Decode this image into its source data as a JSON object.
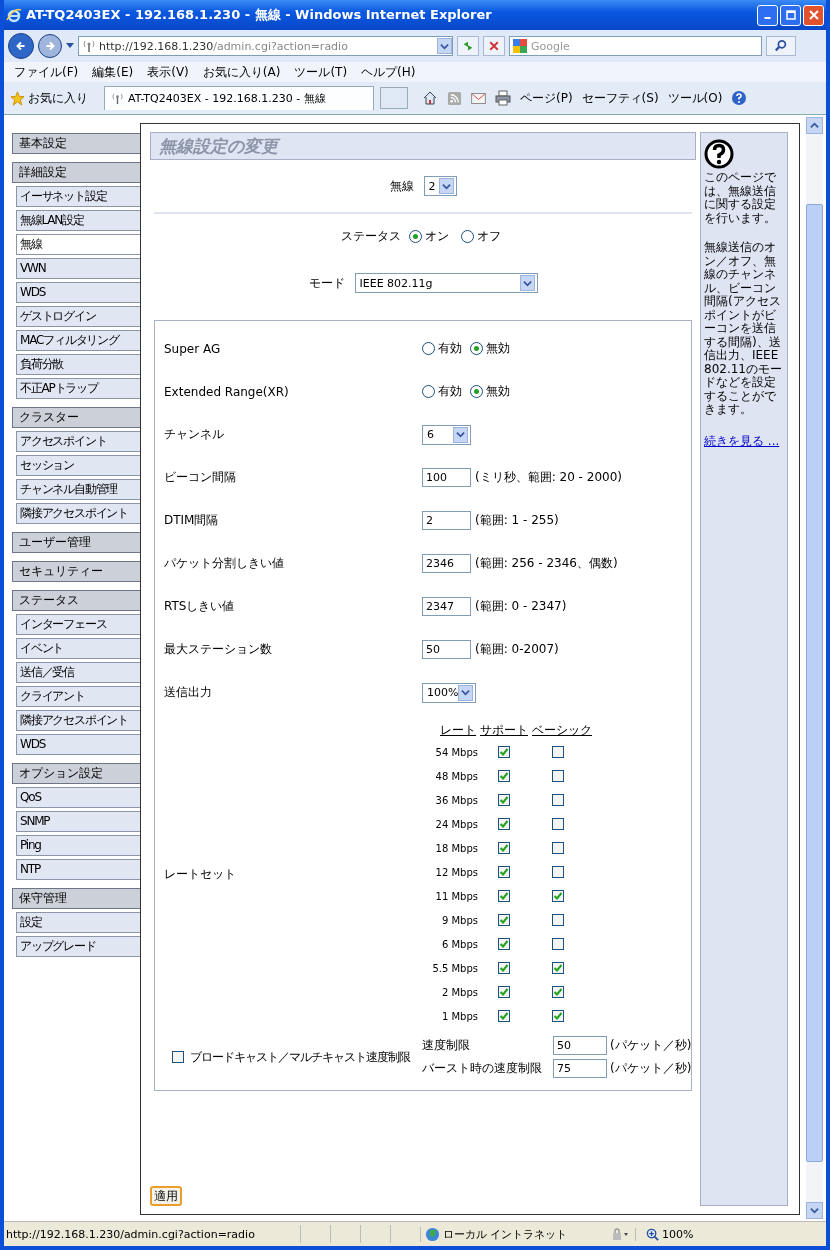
{
  "window": {
    "title": "AT-TQ2403EX - 192.168.1.230 - 無線 - Windows Internet Explorer"
  },
  "address_bar": {
    "host": "http://192.168.1.230",
    "path": "/admin.cgi?action=radio"
  },
  "search_field": {
    "placeholder": "Google"
  },
  "menu_bar": [
    "ファイル(F)",
    "編集(E)",
    "表示(V)",
    "お気に入り(A)",
    "ツール(T)",
    "ヘルプ(H)"
  ],
  "favorites_bar": {
    "favorites": "お気に入り",
    "tab_title": "AT-TQ2403EX - 192.168.1.230 - 無線",
    "commands": [
      "ページ(P)",
      "セーフティ(S)",
      "ツール(O)"
    ]
  },
  "sidebar": [
    {
      "title": "基本設定"
    },
    {
      "title": "詳細設定",
      "items": [
        {
          "label": "イーサネット設定",
          "selected": false
        },
        {
          "label": "無線LAN設定",
          "selected": false
        },
        {
          "label": "無線",
          "selected": true
        },
        {
          "label": "VWN",
          "selected": false
        },
        {
          "label": "WDS",
          "selected": false
        },
        {
          "label": "ゲストログイン",
          "selected": false
        },
        {
          "label": "MACフィルタリング",
          "selected": false
        },
        {
          "label": "負荷分散",
          "selected": false
        },
        {
          "label": "不正APトラップ",
          "selected": false
        }
      ]
    },
    {
      "title": "クラスター",
      "items": [
        {
          "label": "アクセスポイント",
          "selected": false
        },
        {
          "label": "セッション",
          "selected": false
        },
        {
          "label": "チャンネル自動管理",
          "selected": false
        },
        {
          "label": "隣接アクセスポイント",
          "selected": false
        }
      ]
    },
    {
      "title": "ユーザー管理"
    },
    {
      "title": "セキュリティー"
    },
    {
      "title": "ステータス",
      "items": [
        {
          "label": "インターフェース",
          "selected": false
        },
        {
          "label": "イベント",
          "selected": false
        },
        {
          "label": "送信／受信",
          "selected": false
        },
        {
          "label": "クライアント",
          "selected": false
        },
        {
          "label": "隣接アクセスポイント",
          "selected": false
        },
        {
          "label": "WDS",
          "selected": false
        }
      ]
    },
    {
      "title": "オプション設定",
      "items": [
        {
          "label": "QoS",
          "selected": false
        },
        {
          "label": "SNMP",
          "selected": false
        },
        {
          "label": "Ping",
          "selected": false
        },
        {
          "label": "NTP",
          "selected": false
        }
      ]
    },
    {
      "title": "保守管理",
      "items": [
        {
          "label": "設定",
          "selected": false
        },
        {
          "label": "アップグレード",
          "selected": false
        }
      ]
    }
  ],
  "page": {
    "title": "無線設定の変更",
    "radio_select": {
      "label": "無線",
      "value": "2"
    },
    "status": {
      "label": "ステータス",
      "options": [
        {
          "label": "オン",
          "selected": true
        },
        {
          "label": "オフ",
          "selected": false
        }
      ]
    },
    "mode": {
      "label": "モード",
      "value": "IEEE 802.11g"
    },
    "settings": [
      {
        "kind": "radio",
        "label": "Super AG",
        "options": [
          {
            "label": "有効",
            "selected": false
          },
          {
            "label": "無効",
            "selected": true
          }
        ]
      },
      {
        "kind": "radio",
        "label": "Extended Range(XR)",
        "options": [
          {
            "label": "有効",
            "selected": false
          },
          {
            "label": "無効",
            "selected": true
          }
        ]
      },
      {
        "kind": "select",
        "label": "チャンネル",
        "value": "6"
      },
      {
        "kind": "text",
        "label": "ビーコン間隔",
        "value": "100",
        "hint": "(ミリ秒、範囲: 20 - 2000)"
      },
      {
        "kind": "text",
        "label": "DTIM間隔",
        "value": "2",
        "hint": "(範囲: 1 - 255)"
      },
      {
        "kind": "text",
        "label": "パケット分割しきい値",
        "value": "2346",
        "hint": "(範囲: 256 - 2346、偶数)"
      },
      {
        "kind": "text",
        "label": "RTSしきい値",
        "value": "2347",
        "hint": "(範囲: 0 - 2347)"
      },
      {
        "kind": "text",
        "label": "最大ステーション数",
        "value": "50",
        "hint": "(範囲: 0-2007)"
      },
      {
        "kind": "select",
        "label": "送信出力",
        "value": "100%"
      }
    ],
    "rate_set": {
      "label": "レートセット",
      "headers": [
        "レート",
        "サポート",
        "ベーシック"
      ],
      "rows": [
        {
          "rate": "54 Mbps",
          "supported": true,
          "basic": false
        },
        {
          "rate": "48 Mbps",
          "supported": true,
          "basic": false
        },
        {
          "rate": "36 Mbps",
          "supported": true,
          "basic": false
        },
        {
          "rate": "24 Mbps",
          "supported": true,
          "basic": false
        },
        {
          "rate": "18 Mbps",
          "supported": true,
          "basic": false
        },
        {
          "rate": "12 Mbps",
          "supported": true,
          "basic": false
        },
        {
          "rate": "11 Mbps",
          "supported": true,
          "basic": true
        },
        {
          "rate": "9 Mbps",
          "supported": true,
          "basic": false
        },
        {
          "rate": "6 Mbps",
          "supported": true,
          "basic": false
        },
        {
          "rate": "5.5 Mbps",
          "supported": true,
          "basic": true
        },
        {
          "rate": "2 Mbps",
          "supported": true,
          "basic": true
        },
        {
          "rate": "1 Mbps",
          "supported": true,
          "basic": true
        }
      ]
    },
    "broadcast": {
      "label": "ブロードキャスト／マルチキャスト速度制限",
      "checked": false,
      "fields": [
        {
          "label": "速度制限",
          "value": "50",
          "unit": "(パケット／秒)"
        },
        {
          "label": "バースト時の速度制限",
          "value": "75",
          "unit": "(パケット／秒)"
        }
      ]
    },
    "apply_button": "適用"
  },
  "help": {
    "paragraphs": [
      "このページでは、無線送信に関する設定を行います。",
      "無線送信のオン／オフ、無線のチャンネル、ビーコン間隔(アクセスポイントがビーコンを送信する間隔)、送信出力、IEEE802.11のモードなどを設定することができます。"
    ],
    "link": "続きを見る ..."
  },
  "status_bar": {
    "url": "http://192.168.1.230/admin.cgi?action=radio",
    "zone": "ローカル イントラネット",
    "zoom": "100%"
  }
}
